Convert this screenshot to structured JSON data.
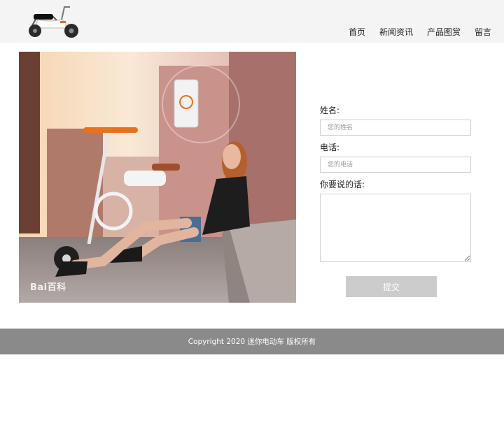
{
  "header": {
    "logo_icon": "scooter-logo",
    "nav": [
      {
        "label": "首页"
      },
      {
        "label": "新闻资讯"
      },
      {
        "label": "产品图赏"
      },
      {
        "label": "留言"
      }
    ]
  },
  "photo": {
    "watermark": "Bai百科"
  },
  "form": {
    "name_label": "姓名:",
    "name_placeholder": "您的姓名",
    "phone_label": "电话:",
    "phone_placeholder": "您的电话",
    "message_label": "你要说的话:",
    "submit_label": "提交"
  },
  "footer": {
    "copyright": "Copyright 2020 迷你电动车 版权所有"
  },
  "colors": {
    "header_bg": "#f4f4f4",
    "footer_bg": "#8a8a8a",
    "button_bg": "#cccccc"
  }
}
